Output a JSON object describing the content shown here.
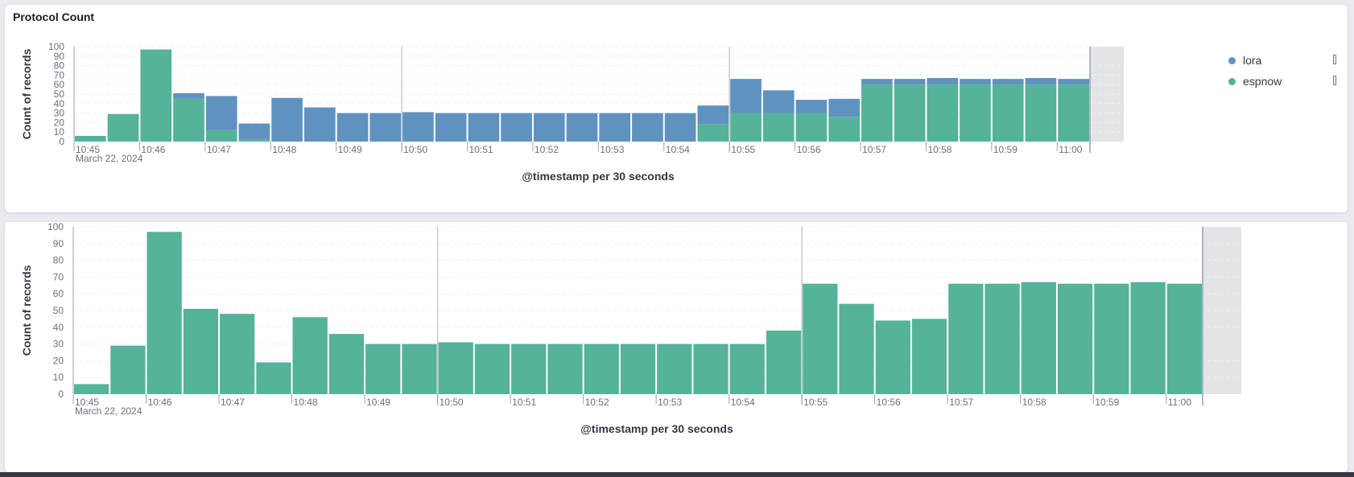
{
  "colors": {
    "lora": "#6092c0",
    "espnow": "#54b399",
    "grid": "#eef0f3",
    "axis": "#98a2b3",
    "marker": "#c6c9cf",
    "future_zone": "#e3e4e8"
  },
  "top_panel": {
    "title": "Protocol Count",
    "legend": [
      {
        "label": "lora",
        "color": "#6092c0"
      },
      {
        "label": "espnow",
        "color": "#54b399"
      }
    ]
  },
  "chart_data": [
    {
      "type": "bar",
      "stacked": true,
      "x_tick_labels": [
        "10:45",
        "10:46",
        "10:47",
        "10:48",
        "10:49",
        "10:50",
        "10:51",
        "10:52",
        "10:53",
        "10:54",
        "10:55",
        "10:56",
        "10:57",
        "10:58",
        "10:59",
        "11:00"
      ],
      "x_sublabel": "March 22, 2024",
      "xlabel": "@timestamp per 30 seconds",
      "ylabel": "Count of records",
      "ylim": [
        0,
        100
      ],
      "y_ticks": [
        0,
        10,
        20,
        30,
        40,
        50,
        60,
        70,
        80,
        90,
        100
      ],
      "series": [
        {
          "name": "espnow",
          "values": [
            6,
            29,
            97,
            45,
            12,
            2,
            0,
            0,
            0,
            0,
            0,
            0,
            0,
            0,
            0,
            0,
            0,
            0,
            0,
            18,
            30,
            30,
            30,
            26,
            60,
            60,
            60,
            60,
            60,
            60,
            60
          ]
        },
        {
          "name": "lora",
          "values": [
            0,
            0,
            0,
            6,
            36,
            17,
            46,
            36,
            30,
            30,
            31,
            30,
            30,
            30,
            30,
            30,
            30,
            30,
            30,
            20,
            36,
            24,
            14,
            19,
            6,
            6,
            7,
            6,
            6,
            7,
            6
          ]
        }
      ],
      "grid": true,
      "legend_position": "right"
    },
    {
      "type": "bar",
      "x_tick_labels": [
        "10:45",
        "10:46",
        "10:47",
        "10:48",
        "10:49",
        "10:50",
        "10:51",
        "10:52",
        "10:53",
        "10:54",
        "10:55",
        "10:56",
        "10:57",
        "10:58",
        "10:59",
        "11:00"
      ],
      "x_sublabel": "March 22, 2024",
      "xlabel": "@timestamp per 30 seconds",
      "ylabel": "Count of records",
      "ylim": [
        0,
        100
      ],
      "y_ticks": [
        0,
        10,
        20,
        30,
        40,
        50,
        60,
        70,
        80,
        90,
        100
      ],
      "values": [
        6,
        29,
        97,
        51,
        48,
        19,
        46,
        36,
        30,
        30,
        31,
        30,
        30,
        30,
        30,
        30,
        30,
        30,
        30,
        38,
        66,
        54,
        44,
        45,
        66,
        66,
        67,
        66,
        66,
        67,
        66
      ],
      "grid": true
    }
  ]
}
